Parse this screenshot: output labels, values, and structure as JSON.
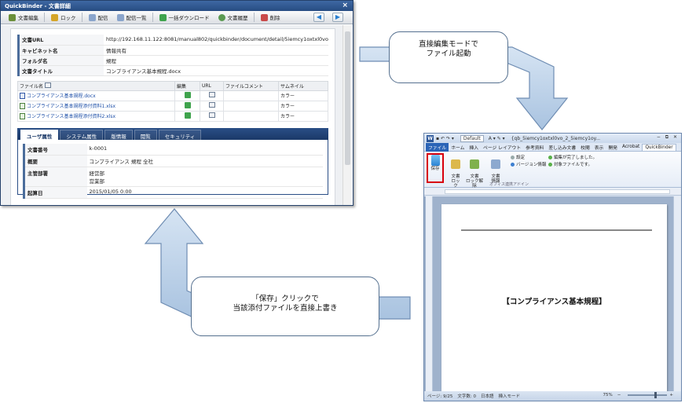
{
  "qb": {
    "title": "QuickBinder - 文書詳細",
    "close": "×",
    "toolbar": [
      "文書編集",
      "ロック",
      "配信",
      "配信一覧",
      "一括ダウンロード",
      "文書履歴",
      "削除"
    ],
    "meta": [
      {
        "label": "文書URL",
        "value": "http://192.168.11.122:8081/manual802/quickbinder/document/detail/5iemcy1oxtxl0vo"
      },
      {
        "label": "キャビネット名",
        "value": "情報共有"
      },
      {
        "label": "フォルダ名",
        "value": "規程"
      },
      {
        "label": "文書タイトル",
        "value": "コンプライアンス基本規程.docx"
      }
    ],
    "files": {
      "headers": [
        "ファイル名",
        "編集",
        "URL",
        "ファイルコメント",
        "サムネイル"
      ],
      "rows": [
        {
          "name": "コンプライアンス基本規程.docx",
          "thumb": "カラー"
        },
        {
          "name": "コンプライアンス基本規程添付資料1.xlsx",
          "thumb": "カラー"
        },
        {
          "name": "コンプライアンス基本規程添付資料2.xlsx",
          "thumb": "カラー"
        }
      ]
    },
    "tabs": [
      "ユーザ属性",
      "システム属性",
      "版情報",
      "閲覧",
      "セキュリティ"
    ],
    "attrs": [
      {
        "label": "文書番号",
        "value": "k-0001"
      },
      {
        "label": "概要",
        "value": "コンプライアンス 規程 全社"
      },
      {
        "label": "主管部署",
        "value": "経営部\n営業部"
      },
      {
        "label": "起算日",
        "value": "2015/01/05 0:00"
      }
    ]
  },
  "callouts": {
    "top": "直接編集モードで\nファイル起動",
    "bottom": "「保存」クリックで\n当該添付ファイルを直接上書き"
  },
  "word": {
    "logo": "W",
    "font": "Default",
    "title": "{qb_5iemcy1oxtxl0vo_2_5iemcy1oy...",
    "win_controls": "− ⧉ ✕",
    "tabs": [
      "ファイル",
      "ホーム",
      "挿入",
      "ページ レイアウト",
      "参考資料",
      "差し込み文書",
      "校閲",
      "表示",
      "開発",
      "Acrobat",
      "QuickBinder"
    ],
    "ribbon": {
      "save": "保存",
      "lock": "文書\nロック",
      "unlock": "文書\nロック解除",
      "info": "文書\n情報",
      "settings": "設定",
      "version": "バージョン情報",
      "edit_done": "編集が完了しました。",
      "editable": "対象ファイルです。",
      "group": "オフィス連携アドイン"
    },
    "doc_title": "【コンプライアンス基本規程】",
    "status": [
      "ページ: 9/25",
      "文字数: 0",
      "日本語",
      "挿入モード"
    ],
    "zoom": "75%"
  },
  "colors": {
    "qb_header": "#274c82",
    "accent_red": "#d8000c",
    "arrow_fill": "#b9d1ea"
  }
}
